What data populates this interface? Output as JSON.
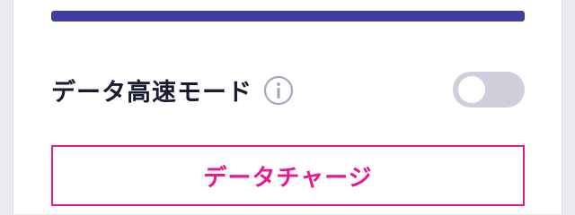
{
  "colors": {
    "progress": "#3f3d9e",
    "accent": "#e6198d",
    "toggle_off": "#cfcfdc",
    "info_icon": "#a7a6bc"
  },
  "data_usage": {
    "progress_fraction": 1.0
  },
  "data_speed_mode": {
    "label": "データ高速モード",
    "enabled": false,
    "info_icon": "info-circle-icon"
  },
  "charge_button": {
    "label": "データチャージ"
  }
}
